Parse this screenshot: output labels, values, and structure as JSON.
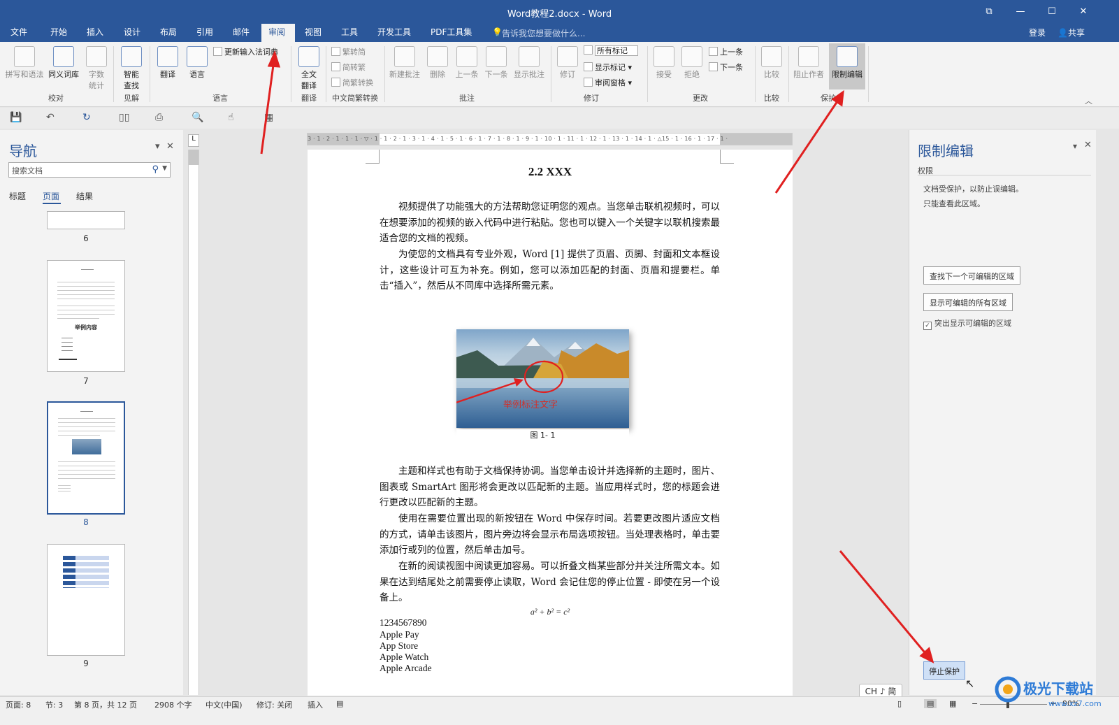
{
  "window": {
    "title": "Word教程2.docx - Word",
    "restore_glyph": "⧉",
    "minimize_glyph": "—",
    "maximize_glyph": "☐",
    "close_glyph": "✕"
  },
  "menu": {
    "tabs": [
      "文件",
      "开始",
      "插入",
      "设计",
      "布局",
      "引用",
      "邮件",
      "审阅",
      "视图",
      "工具",
      "开发工具",
      "PDF工具集"
    ],
    "active_tab": "审阅",
    "tell_me": "告诉我您想要做什么...",
    "login": "登录",
    "share": "共享"
  },
  "ribbon": {
    "proofing": {
      "spelling": "拼写和语法",
      "thesaurus": "同义词库",
      "wordcount_l1": "字数",
      "wordcount_l2": "统计",
      "group": "校对"
    },
    "insights": {
      "smart_l1": "智能",
      "smart_l2": "查找",
      "group": "见解"
    },
    "language": {
      "translate": "翻译",
      "language": "语言",
      "update_ime": "更新输入法词典",
      "group": "语言"
    },
    "translation": {
      "full_l1": "全文",
      "full_l2": "翻译",
      "group": "翻译"
    },
    "chinese": {
      "to_trad": "繁转简",
      "to_simp": "简转繁",
      "convert": "简繁转换",
      "group": "中文简繁转换"
    },
    "comments": {
      "new": "新建批注",
      "delete": "删除",
      "prev": "上一条",
      "next": "下一条",
      "show": "显示批注",
      "group": "批注"
    },
    "tracking": {
      "track": "修订",
      "all_markup": "所有标记",
      "show_markup": "显示标记",
      "review_pane": "审阅窗格",
      "group": "修订"
    },
    "changes": {
      "accept": "接受",
      "reject": "拒绝",
      "prev": "上一条",
      "next": "下一条",
      "group": "更改"
    },
    "compare": {
      "compare": "比较",
      "group": "比较"
    },
    "protect": {
      "block_authors": "阻止作者",
      "restrict": "限制编辑",
      "group": "保护"
    }
  },
  "navigation": {
    "title": "导航",
    "search_placeholder": "搜索文档",
    "tabs": [
      "标题",
      "页面",
      "结果"
    ],
    "active_tab": "页面",
    "pages": [
      "6",
      "7",
      "8",
      "9"
    ],
    "selected_page": "8",
    "thumb7_heading": "举例内容"
  },
  "document": {
    "heading": "2.2 XXX",
    "paragraphs": [
      "视频提供了功能强大的方法帮助您证明您的观点。当您单击联机视频时，可以在想要添加的视频的嵌入代码中进行粘贴。您也可以键入一个关键字以联机搜索最适合您的文档的视频。",
      "为使您的文档具有专业外观，Word [1] 提供了页眉、页脚、封面和文本框设计，这些设计可互为补充。例如，您可以添加匹配的封面、页眉和提要栏。单击“插入”，然后从不同库中选择所需元素。",
      "主题和样式也有助于文档保持协调。当您单击设计并选择新的主题时，图片、图表或 SmartArt 图形将会更改以匹配新的主题。当应用样式时，您的标题会进行更改以匹配新的主题。",
      "使用在需要位置出现的新按钮在 Word 中保存时间。若要更改图片适应文档的方式，请单击该图片，图片旁边将会显示布局选项按钮。当处理表格时，单击要添加行或列的位置，然后单击加号。",
      "在新的阅读视图中阅读更加容易。可以折叠文档某些部分并关注所需文本。如果在达到结尾处之前需要停止读取，Word 会记住您的停止位置 - 即使在另一个设备上。"
    ],
    "image_annotation": "举例标注文字",
    "caption": "图 1- 1",
    "equation": "a² + b² = c²",
    "list": [
      "1234567890",
      "Apple Pay",
      "App Store",
      "Apple Watch",
      "Apple Arcade"
    ],
    "ruler_text": "3 · 1 · 2 · 1 · 1 · 1 · ▽ · 1 · 1 · 2 · 1 · 3 · 1 · 4 · 1 · 5 · 1 · 6 · 1 · 7 · 1 · 8 · 1 · 9 · 1 · 10 · 1 · 11 · 1 · 12 · 1 · 13 · 1 · 14 · 1 · △15 · 1 · 16 · 1 · 17 · 1 ·",
    "vruler_tab": "L"
  },
  "restrict_pane": {
    "title": "限制编辑",
    "section": "权限",
    "msg1": "文档受保护，以防止误编辑。",
    "msg2": "只能查看此区域。",
    "find_next": "查找下一个可编辑的区域",
    "show_all": "显示可编辑的所有区域",
    "highlight": "突出显示可编辑的区域",
    "highlight_checked": true,
    "stop": "停止保护"
  },
  "status": {
    "page": "页面: 8",
    "section": "节: 3",
    "page_of": "第 8 页，共 12 页",
    "words": "2908 个字",
    "lang": "中文(中国)",
    "track": "修订: 关闭",
    "insert": "插入",
    "zoom": "90%",
    "zoom_minus": "−",
    "zoom_plus": "+"
  },
  "ime": "CH ♪ 简",
  "watermark": {
    "brand": "极光下载站",
    "url": "www.xz7.com"
  },
  "colors": {
    "accent": "#2b579a",
    "arrow": "#e02020"
  }
}
